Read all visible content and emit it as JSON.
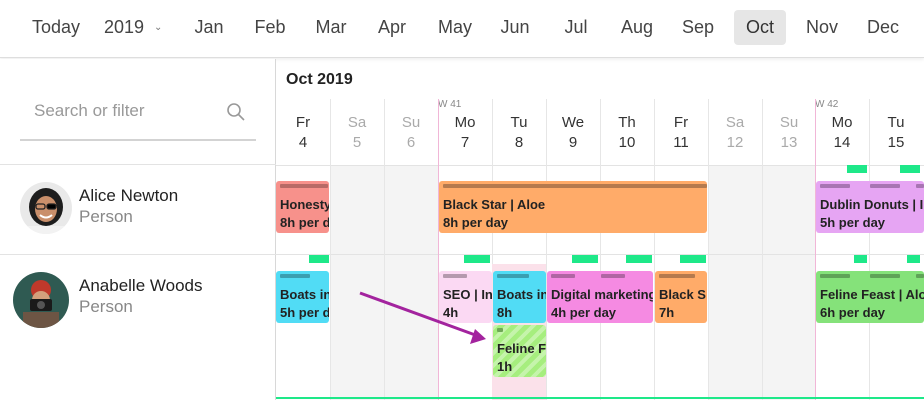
{
  "topbar": {
    "today": "Today",
    "year": "2019",
    "months": [
      "Jan",
      "Feb",
      "Mar",
      "Apr",
      "May",
      "Jun",
      "Jul",
      "Aug",
      "Sep",
      "Oct",
      "Nov",
      "Dec"
    ],
    "active_month": "Oct"
  },
  "search": {
    "placeholder": "Search or filter"
  },
  "people": [
    {
      "name": "Alice Newton",
      "role": "Person"
    },
    {
      "name": "Anabelle Woods",
      "role": "Person"
    }
  ],
  "calendar": {
    "month_title": "Oct 2019",
    "weeks": [
      "W 41",
      "W 42"
    ],
    "days": [
      {
        "name": "Fr",
        "num": "4",
        "weekend": false
      },
      {
        "name": "Sa",
        "num": "5",
        "weekend": true
      },
      {
        "name": "Su",
        "num": "6",
        "weekend": true
      },
      {
        "name": "Mo",
        "num": "7",
        "weekend": false
      },
      {
        "name": "Tu",
        "num": "8",
        "weekend": false
      },
      {
        "name": "We",
        "num": "9",
        "weekend": false
      },
      {
        "name": "Th",
        "num": "10",
        "weekend": false
      },
      {
        "name": "Fr",
        "num": "11",
        "weekend": false
      },
      {
        "name": "Sa",
        "num": "12",
        "weekend": true
      },
      {
        "name": "Su",
        "num": "13",
        "weekend": true
      },
      {
        "name": "Mo",
        "num": "14",
        "weekend": false
      },
      {
        "name": "Tu",
        "num": "15",
        "weekend": false
      }
    ]
  },
  "tasks": [
    {
      "title": "Honesty",
      "detail": "8h per d",
      "color": "#f7918b",
      "stripe": "#b86a66"
    },
    {
      "title": "Black Star | Aloe",
      "detail": "8h per day",
      "color": "#ffab69",
      "stripe": "#b57a4e"
    },
    {
      "title": "Dublin Donuts | In",
      "detail": "5h per day",
      "color": "#e6a5f3",
      "stripe": "#a875b3"
    },
    {
      "title": "Boats in",
      "detail": "5h per d",
      "color": "#51dcf5",
      "stripe": "#3a9fb1"
    },
    {
      "title": "SEO | In",
      "detail": "4h",
      "color": "#fbd9f3",
      "stripe": "#b49aae"
    },
    {
      "title": "Boats in",
      "detail": "8h",
      "color": "#51dcf5",
      "stripe": "#3a9fb1"
    },
    {
      "title": "Digital marketing",
      "detail": "4h per day",
      "color": "#f58ae2",
      "stripe": "#b065a3"
    },
    {
      "title": "Black S",
      "detail": "7h",
      "color": "#ffab69",
      "stripe": "#b57a4e"
    },
    {
      "title": "Feline Feast | Aloe",
      "detail": "6h per day",
      "color": "#85e27a",
      "stripe": "#5fa357"
    },
    {
      "title": "Feline F",
      "detail": "1h",
      "color": "#a6ee7e",
      "stripe": "#6fa856"
    }
  ],
  "colors": {
    "accent_green": "#1ee889",
    "today_line": "#f1b6d7",
    "arrow": "#a3239e"
  }
}
